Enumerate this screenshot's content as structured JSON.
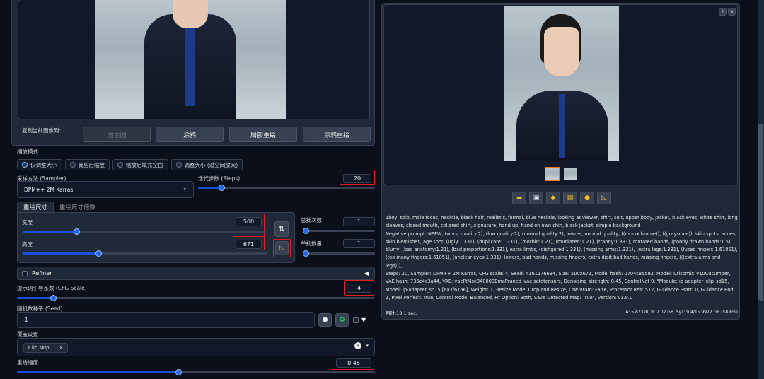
{
  "top": {
    "copy_label": "复制当前图像到:",
    "copy_buttons": [
      "图生图",
      "涂鸦",
      "局部重绘",
      "涂鸦重绘"
    ]
  },
  "resize": {
    "title": "缩放模式",
    "options": [
      "仅调整大小",
      "裁剪后缩放",
      "缩放后填充空白",
      "调整大小 (潜空间放大)"
    ],
    "selected_index": 0
  },
  "sampler": {
    "label": "采样方法 (Sampler)",
    "value": "DPM++ 2M Karras",
    "steps_label": "迭代步数 (Steps)",
    "steps_value": "20",
    "steps_fraction": 0.13
  },
  "size_tabs": {
    "active": "重绘尺寸",
    "inactive": "重绘尺寸倍数"
  },
  "width": {
    "label": "宽度",
    "value": "500",
    "fraction": 0.22
  },
  "height": {
    "label": "高度",
    "value": "671",
    "fraction": 0.31
  },
  "swap_icon": "swap-arrows-icon",
  "ratio_icon": "ruler-triangle-icon",
  "batch_count": {
    "label": "总批次数",
    "value": "1",
    "fraction": 0.0
  },
  "batch_size": {
    "label": "单批数量",
    "value": "1",
    "fraction": 0.0
  },
  "refiner": {
    "label": "Refiner"
  },
  "cfg": {
    "label": "提示词引导系数 (CFG Scale)",
    "value": "4",
    "fraction": 0.1
  },
  "seed": {
    "label": "随机数种子 (Seed)",
    "value": "-1"
  },
  "override": {
    "label": "覆盖设置",
    "chip": "Clip skip: 1"
  },
  "denoise": {
    "label": "重绘幅度",
    "value": "0.45",
    "fraction": 0.45
  },
  "output": {
    "prompt": "1boy, solo, male focus, necktie, black hair, realistic, formal, blue necktie, looking at viewer, shirt, suit, upper body, jacket, black eyes, white shirt, long sleeves, closed mouth, collared shirt, signature, hand up, hand on own chin, black jacket, simple background",
    "negative": "Negative prompt: NSFW, (worst quality:2), (low quality:2), (normal quality:2), lowres, normal quality, ((monochrome)), ((grayscale)), skin spots, acnes, skin blemishes, age spot, (ugly:1.331), (duplicate:1.331), (morbid:1.21), (mutilated:1.21), (tranny:1.331), mutated hands, (poorly drawn hands:1.5), blurry, (bad anatomy:1.21), (bad proportions:1.331), extra limbs, (disfigured:1.331), (missing arms:1.331), (extra legs:1.331), (fused fingers:1.61051), (too many fingers:1.61051), (unclear eyes:1.331), lowers, bad hands, missing fingers, extra digit,bad hands, missing fingers, (((extra arms and legs))),",
    "params": "Steps: 20, Sampler: DPM++ 2M Karras, CFG scale: 4, Seed: 4161176694, Size: 500x671, Model hash: 0704c85592, Model: Crispmix_v10Cucumber, VAE hash: 735e4c3a44, VAE: vaeFtMse840000EmaPruned_vae.safetensors, Denoising strength: 0.45, ControlNet 0: \"Module: ip-adapter_clip_sd15, Model: ip-adapter_sd15 [6a3f6166], Weight: 1, Resize Mode: Crop and Resize, Low Vram: False, Processor Res: 512, Guidance Start: 0, Guidance End: 1, Pixel Perfect: True, Control Mode: Balanced, Hr Option: Both, Save Detected Map: True\", Version: v1.8.0",
    "time": "用时:18.1 sec.",
    "memory": "A: 5.87 GB, R: 7.02 GB, Sys: 9.4/15.9922 GB (58.6%)"
  },
  "toolbar_icons": [
    "folder-icon",
    "save-icon",
    "zip-icon",
    "image-send-icon",
    "palette-icon",
    "ruler-icon"
  ],
  "colors": {
    "accent": "#2563eb",
    "highlight": "#e11d2a",
    "background": "#0b0f19",
    "panel": "#1f2937"
  }
}
